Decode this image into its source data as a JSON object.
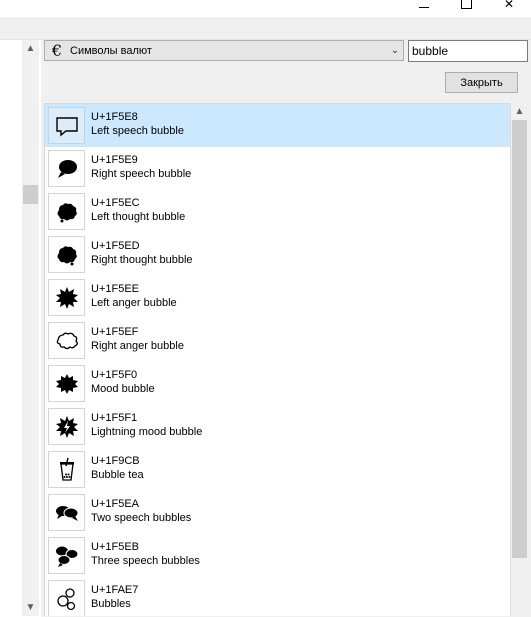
{
  "window": {
    "minimize_icon": "minimize-icon",
    "maximize_icon": "maximize-icon",
    "close_icon": "close-icon"
  },
  "font_combo": {
    "value": "Символы валют",
    "icon_glyph": "€"
  },
  "search": {
    "value": "bubble"
  },
  "close_button": {
    "label": "Закрыть"
  },
  "results": [
    {
      "code": "U+1F5E8",
      "name": "Left speech bubble",
      "icon": "left-speech-bubble-icon",
      "selected": true
    },
    {
      "code": "U+1F5E9",
      "name": "Right speech bubble",
      "icon": "right-speech-bubble-icon"
    },
    {
      "code": "U+1F5EC",
      "name": "Left thought bubble",
      "icon": "left-thought-bubble-icon"
    },
    {
      "code": "U+1F5ED",
      "name": "Right thought bubble",
      "icon": "right-thought-bubble-icon"
    },
    {
      "code": "U+1F5EE",
      "name": "Left anger bubble",
      "icon": "left-anger-bubble-icon"
    },
    {
      "code": "U+1F5EF",
      "name": "Right anger bubble",
      "icon": "right-anger-bubble-icon"
    },
    {
      "code": "U+1F5F0",
      "name": "Mood bubble",
      "icon": "mood-bubble-icon"
    },
    {
      "code": "U+1F5F1",
      "name": "Lightning mood bubble",
      "icon": "lightning-mood-bubble-icon"
    },
    {
      "code": "U+1F9CB",
      "name": "Bubble tea",
      "icon": "bubble-tea-icon"
    },
    {
      "code": "U+1F5EA",
      "name": "Two speech bubbles",
      "icon": "two-speech-bubbles-icon"
    },
    {
      "code": "U+1F5EB",
      "name": "Three speech bubbles",
      "icon": "three-speech-bubbles-icon"
    },
    {
      "code": "U+1FAE7",
      "name": "Bubbles",
      "icon": "bubbles-icon"
    }
  ],
  "colors": {
    "selection": "#cce8ff",
    "panel": "#f0f0f0"
  }
}
